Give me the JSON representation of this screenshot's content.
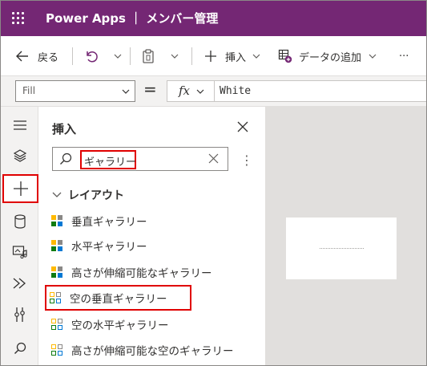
{
  "titlebar": {
    "app_title": "Power Apps ｜ メンバー管理"
  },
  "commandbar": {
    "back_label": "戻る",
    "insert_label": "挿入",
    "add_data_label": "データの追加",
    "more_label": "···"
  },
  "formulabar": {
    "property": "Fill",
    "equals": "=",
    "fx_label": "fx",
    "formula": "White"
  },
  "insert_pane": {
    "title": "挿入",
    "search_value": "ギャラリー",
    "more_label": "⋮",
    "group_label": "レイアウト",
    "items": [
      {
        "label": "垂直ギャラリー"
      },
      {
        "label": "水平ギャラリー"
      },
      {
        "label": "高さが伸縮可能なギャラリー"
      },
      {
        "label": "空の垂直ギャラリー"
      },
      {
        "label": "空の水平ギャラリー"
      },
      {
        "label": "高さが伸縮可能な空のギャラリー"
      }
    ]
  },
  "colors": {
    "titlebar_bg": "#742774",
    "highlight_border": "#e00000",
    "icon_accent": "#ffb900",
    "icon_green": "#107c10"
  }
}
